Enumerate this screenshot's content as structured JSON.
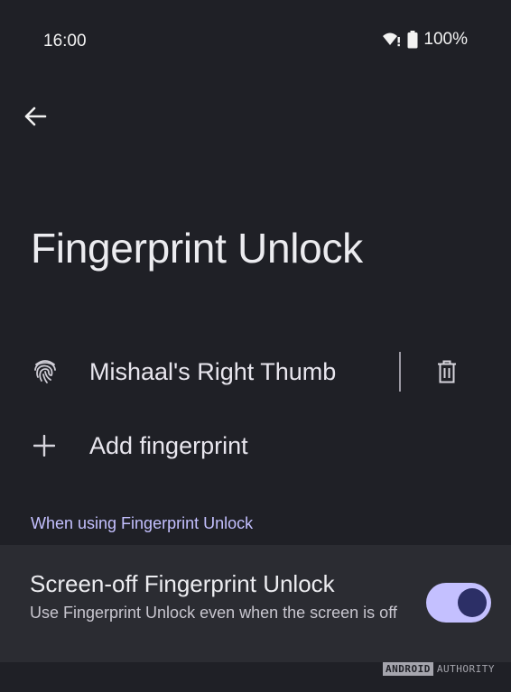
{
  "status_bar": {
    "time": "16:00",
    "battery": "100%",
    "wifi_icon": "wifi-alert-icon",
    "battery_icon": "battery-full-icon"
  },
  "header": {
    "back_icon": "arrow-back-icon",
    "title": "Fingerprint Unlock"
  },
  "fingerprint": {
    "icon": "fingerprint-icon",
    "name": "Mishaal's Right Thumb",
    "delete_icon": "trash-icon"
  },
  "add_fingerprint": {
    "icon": "plus-icon",
    "label": "Add fingerprint"
  },
  "section": {
    "header": "When using Fingerprint Unlock"
  },
  "screen_off_unlock": {
    "title": "Screen-off Fingerprint Unlock",
    "summary": "Use Fingerprint Unlock even when the screen is off",
    "enabled": true
  },
  "watermark": {
    "part1": "ANDROID",
    "part2": "AUTHORITY"
  },
  "colors": {
    "background": "#1f2026",
    "card": "#2b2c32",
    "accent": "#c4c0ff",
    "switch_thumb": "#2c2f66"
  }
}
